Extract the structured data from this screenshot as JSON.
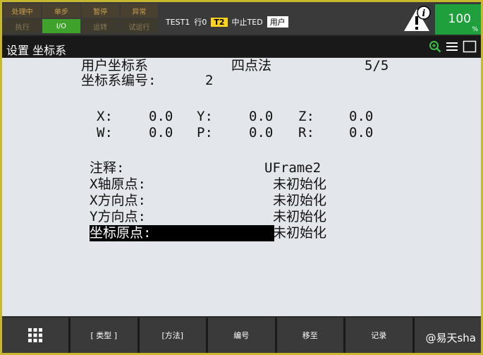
{
  "status": {
    "row1": [
      "处理中",
      "单步",
      "暂停",
      "异常"
    ],
    "row2": [
      "执行",
      "I/O",
      "运转",
      "试运行"
    ]
  },
  "program": {
    "name": "TEST1",
    "line": "行0",
    "mode": "T2",
    "state": "中止TED",
    "user": "用户"
  },
  "override": {
    "value": "100",
    "unit": "%"
  },
  "title": "设置 坐标系",
  "header": {
    "frame_type": "用户坐标系",
    "method": "四点法",
    "page": "5/5",
    "frame_no_label": "坐标系编号:",
    "frame_no": "2"
  },
  "coords": {
    "x_label": "X:",
    "x": "0.0",
    "y_label": "Y:",
    "y": "0.0",
    "z_label": "Z:",
    "z": "0.0",
    "w_label": "W:",
    "w": "0.0",
    "p_label": "P:",
    "p": "0.0",
    "r_label": "R:",
    "r": "0.0"
  },
  "fields": [
    {
      "label": "注释:",
      "value": "UFrame2"
    },
    {
      "label": "X轴原点:",
      "value": "未初始化"
    },
    {
      "label": "X方向点:",
      "value": "未初始化"
    },
    {
      "label": "Y方向点:",
      "value": "未初始化"
    },
    {
      "label": "坐标原点:",
      "value": "未初始化"
    }
  ],
  "fkeys": [
    "[ 类型 ]",
    "[方法]",
    "编号",
    "移至",
    "记录"
  ],
  "watermark": "@易天sha",
  "colors": {
    "frame": "#c8b830",
    "active": "#3fa22a",
    "t2": "#ffd21e",
    "override": "#1fa03c"
  }
}
